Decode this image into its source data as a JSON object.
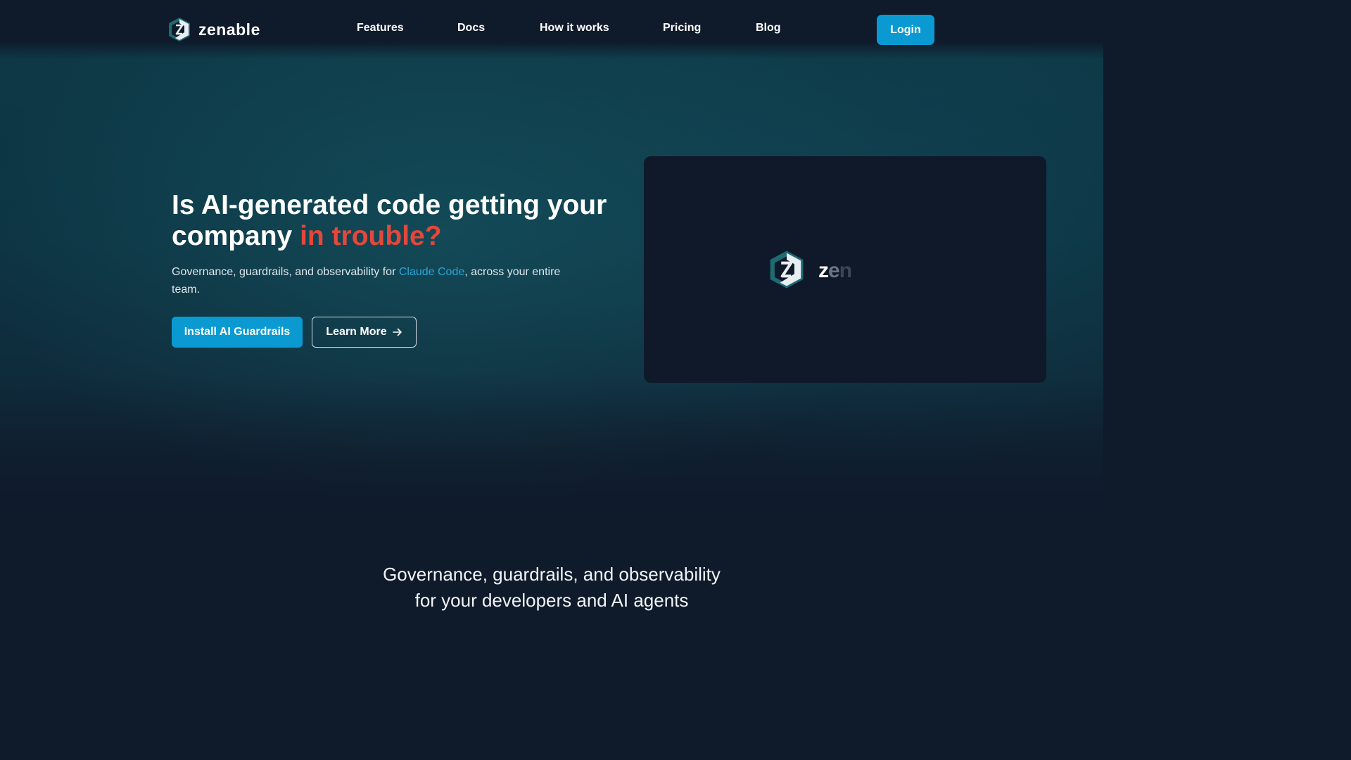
{
  "header": {
    "brand": "zenable",
    "nav": [
      {
        "label": "Features"
      },
      {
        "label": "Docs"
      },
      {
        "label": "How it works"
      },
      {
        "label": "Pricing"
      },
      {
        "label": "Blog"
      }
    ],
    "login_label": "Login"
  },
  "hero": {
    "title_main": "Is AI-generated code getting your company ",
    "title_accent": "in trouble?",
    "subtitle_before": "Governance, guardrails, and observability for ",
    "subtitle_link": "Claude Code",
    "subtitle_after": ", across your entire team.",
    "primary_button": "Install AI Guardrails",
    "secondary_button": "Learn More"
  },
  "preview": {
    "text_part1": "z",
    "text_part2": "e",
    "text_part3": "n"
  },
  "section": {
    "heading_line1": "Governance, guardrails, and observability",
    "heading_line2": "for your developers and AI agents"
  },
  "colors": {
    "accent": "#0a9ad1",
    "danger": "#e4473b",
    "link": "#2aa6db",
    "background": "#0f1a2b"
  }
}
